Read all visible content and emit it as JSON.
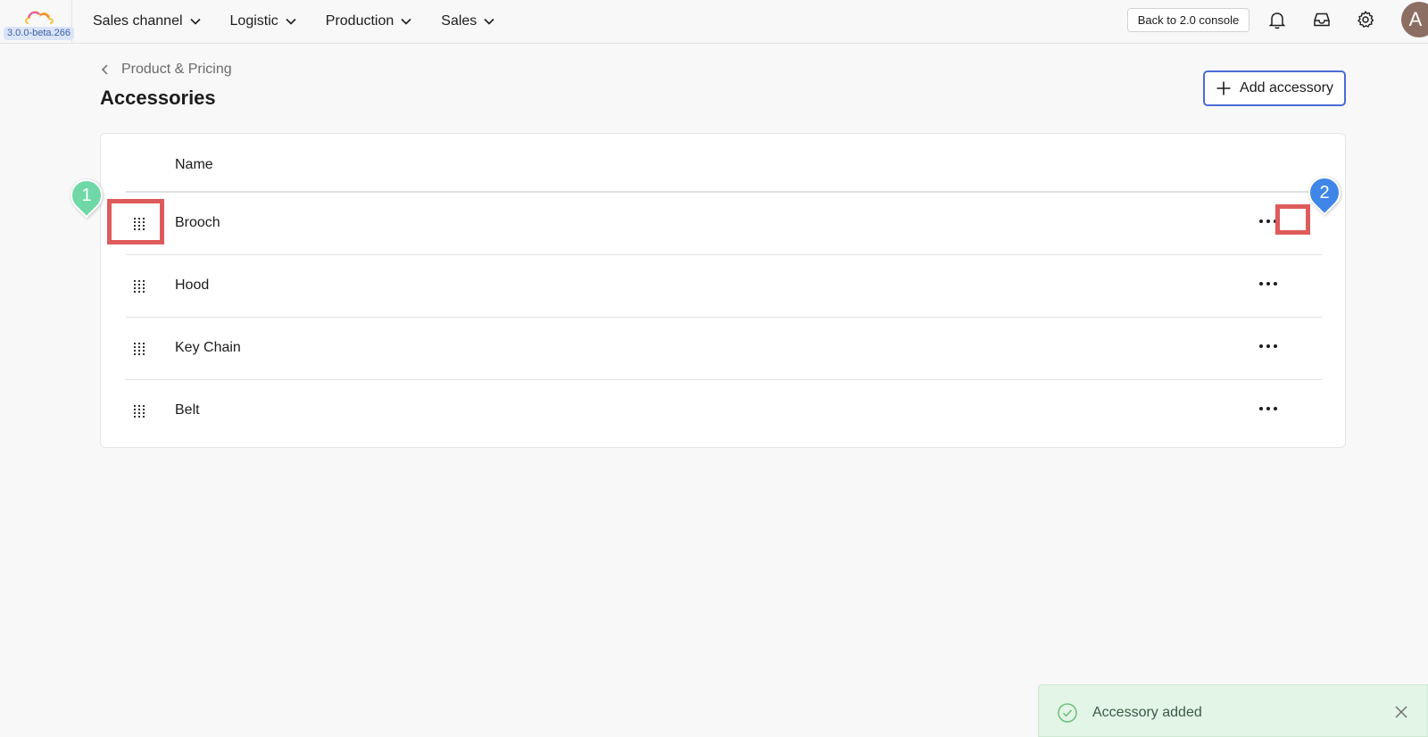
{
  "app": {
    "version": "3.0.0-beta.266",
    "brand_colors": {
      "accent": "#4a6bd6",
      "highlight": "#de5b5b",
      "marker_1": "#6fd8a6",
      "marker_2": "#3f86e8",
      "toast_bg": "#e3f5e6"
    }
  },
  "nav": {
    "items": [
      {
        "label": "Sales channel",
        "icon": "chevron-down-icon"
      },
      {
        "label": "Logistic",
        "icon": "chevron-down-icon"
      },
      {
        "label": "Production",
        "icon": "chevron-down-icon"
      },
      {
        "label": "Sales",
        "icon": "chevron-down-icon"
      }
    ],
    "back_console_label": "Back to 2.0 console",
    "icons": [
      "bell-icon",
      "inbox-icon",
      "gear-icon"
    ],
    "avatar_initial": "A"
  },
  "page": {
    "breadcrumb": "Product & Pricing",
    "title": "Accessories",
    "add_button_label": "Add accessory"
  },
  "table": {
    "column_name": "Name",
    "rows": [
      {
        "name": "Brooch"
      },
      {
        "name": "Hood"
      },
      {
        "name": "Key Chain"
      },
      {
        "name": "Belt"
      }
    ]
  },
  "annotations": {
    "marker_1": "1",
    "marker_2": "2"
  },
  "toast": {
    "message": "Accessory added"
  }
}
